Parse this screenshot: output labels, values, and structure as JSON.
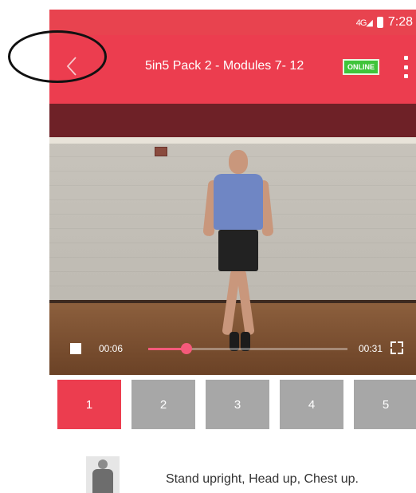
{
  "status_bar": {
    "signal_label": "4G",
    "time": "7:28"
  },
  "toolbar": {
    "back_icon": "chevron-left-icon",
    "title": "5in5 Pack 2 - Modules 7- 12",
    "online_badge": "ONLINE",
    "more_icon": "more-vert-icon",
    "accent_color": "#ec3d4f",
    "badge_color": "#3fc43a"
  },
  "video": {
    "current_time": "00:06",
    "duration": "00:31",
    "progress": 0.19,
    "stop_icon": "stop-icon",
    "fullscreen_icon": "fullscreen-icon"
  },
  "module_tabs": {
    "items": [
      {
        "label": "1",
        "active": true
      },
      {
        "label": "2",
        "active": false
      },
      {
        "label": "3",
        "active": false
      },
      {
        "label": "4",
        "active": false
      },
      {
        "label": "5",
        "active": false
      }
    ]
  },
  "instruction": {
    "text": "Stand upright, Head up, Chest up."
  }
}
